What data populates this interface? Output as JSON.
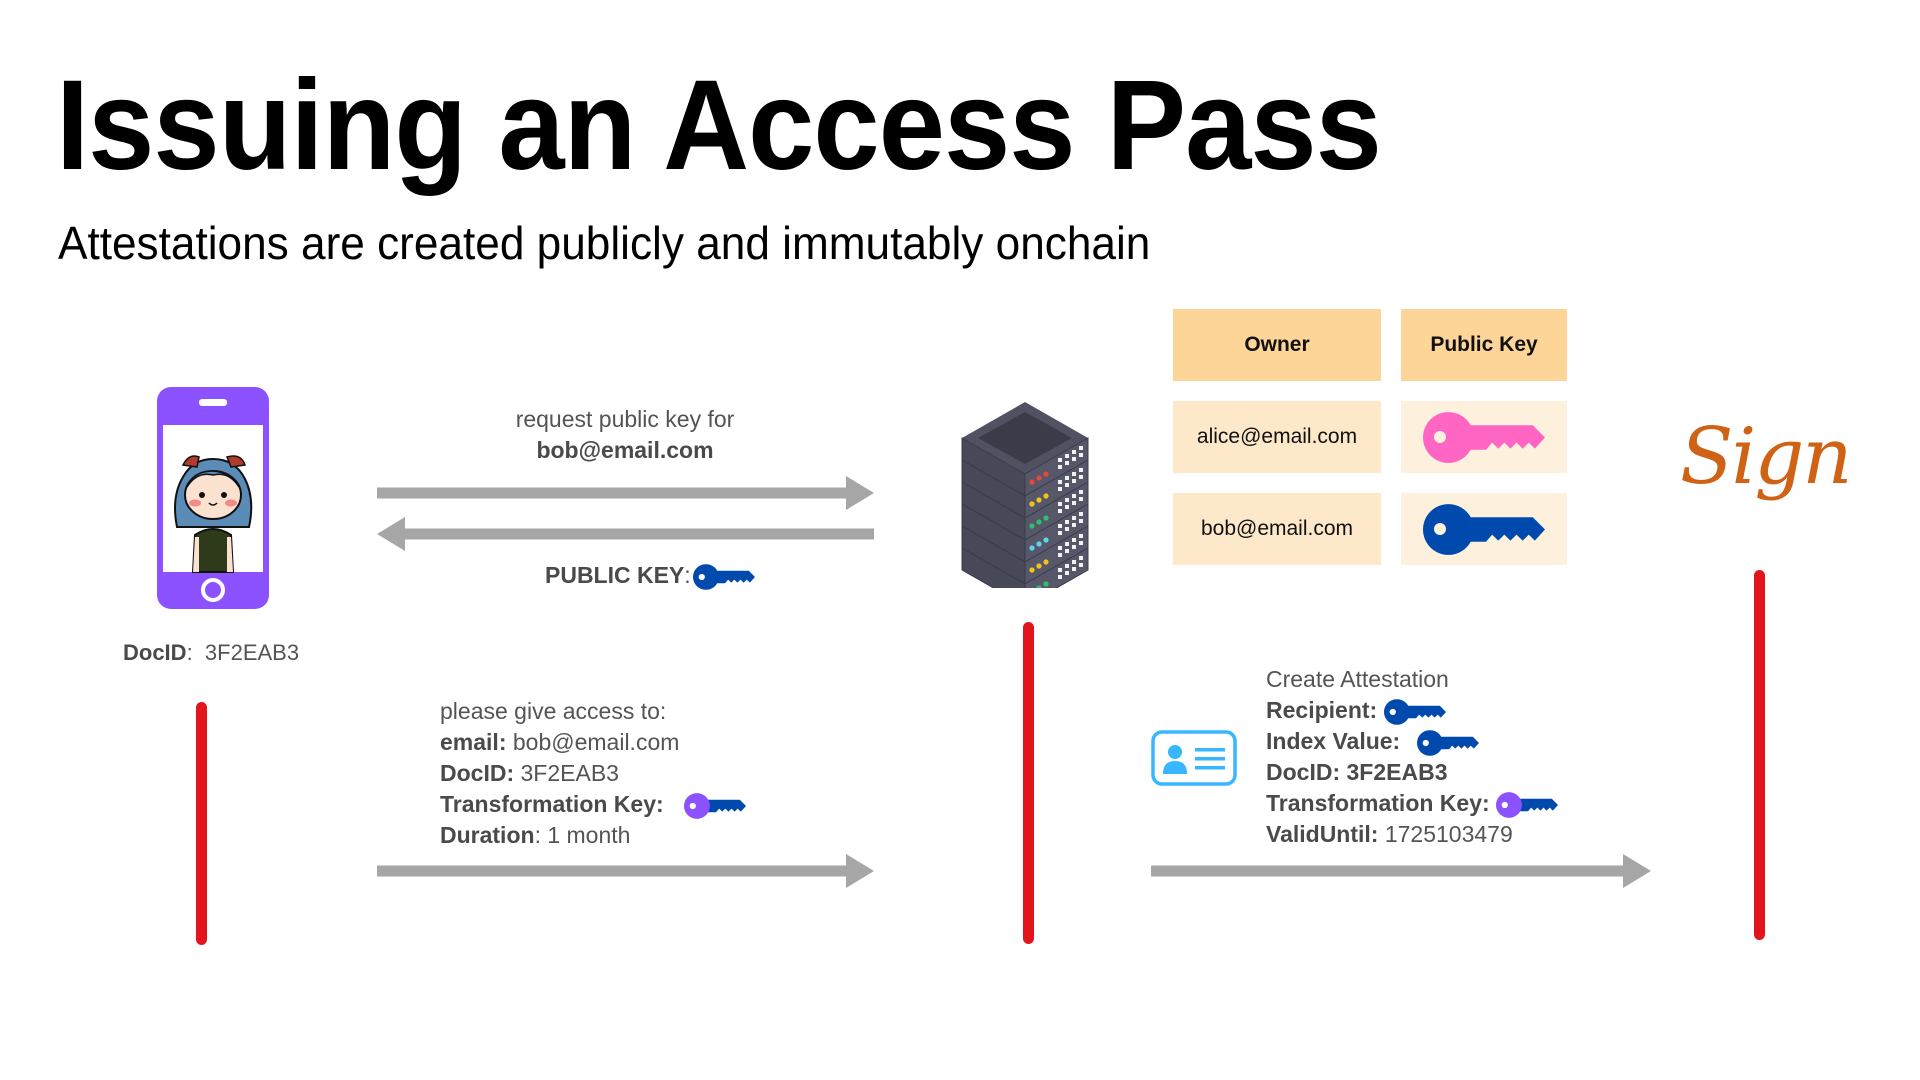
{
  "title": "Issuing an Access Pass",
  "subtitle": "Attestations are created publicly and immutably onchain",
  "colors": {
    "phone": "#8c52ff",
    "lifeline": "#e3151c",
    "arrow": "#a6a6a6",
    "table_header": "#fdd598",
    "table_row": "#fde9c9",
    "key_alice": "#ff66c4",
    "key_bob": "#004aad",
    "transformation_key_bow": "#8c52ff",
    "id_card": "#38b6ff",
    "sign_logo": "#cf6214"
  },
  "actors": {
    "phone": {
      "icon": "smartphone-with-avatar",
      "docid_label": "DocID",
      "docid_value": "3F2EAB3"
    },
    "server": {
      "icon": "server-rack"
    },
    "sign": {
      "label": "Sign"
    }
  },
  "registry_table": {
    "headers": [
      "Owner",
      "Public Key"
    ],
    "rows": [
      {
        "owner": "alice@email.com",
        "key_icon": "key-icon",
        "key_color": "pink"
      },
      {
        "owner": "bob@email.com",
        "key_icon": "key-icon",
        "key_color": "blue"
      }
    ]
  },
  "messages": {
    "request": {
      "line1": "request public key for",
      "line2": "bob@email.com",
      "direction": "phone-to-server"
    },
    "response": {
      "label": "PUBLIC KEY",
      "sep": ":",
      "key_icon": "blue-key-icon",
      "direction": "server-to-phone"
    },
    "access_request": {
      "intro": "please give access to:",
      "fields": [
        {
          "label": "email:",
          "value": " bob@email.com"
        },
        {
          "label": "DocID:",
          "value": " 3F2EAB3"
        },
        {
          "label": "Transformation Key:",
          "value": "",
          "icon": "transformation-key-icon"
        },
        {
          "label": "Duration",
          "value": ": 1 month"
        }
      ],
      "direction": "phone-to-server"
    },
    "attestation": {
      "intro": "Create Attestation",
      "fields": [
        {
          "label": "Recipient:",
          "value": "",
          "icon": "blue-key-icon"
        },
        {
          "label": "Index Value:",
          "value": "",
          "icon": "blue-key-icon"
        },
        {
          "label": "DocID: 3F2EAB3",
          "value": ""
        },
        {
          "label": "Transformation Key:",
          "value": "",
          "icon": "transformation-key-icon"
        },
        {
          "label": "ValidUntil:",
          "value": " 1725103479"
        }
      ],
      "icon": "id-card-icon",
      "direction": "server-to-sign"
    }
  }
}
